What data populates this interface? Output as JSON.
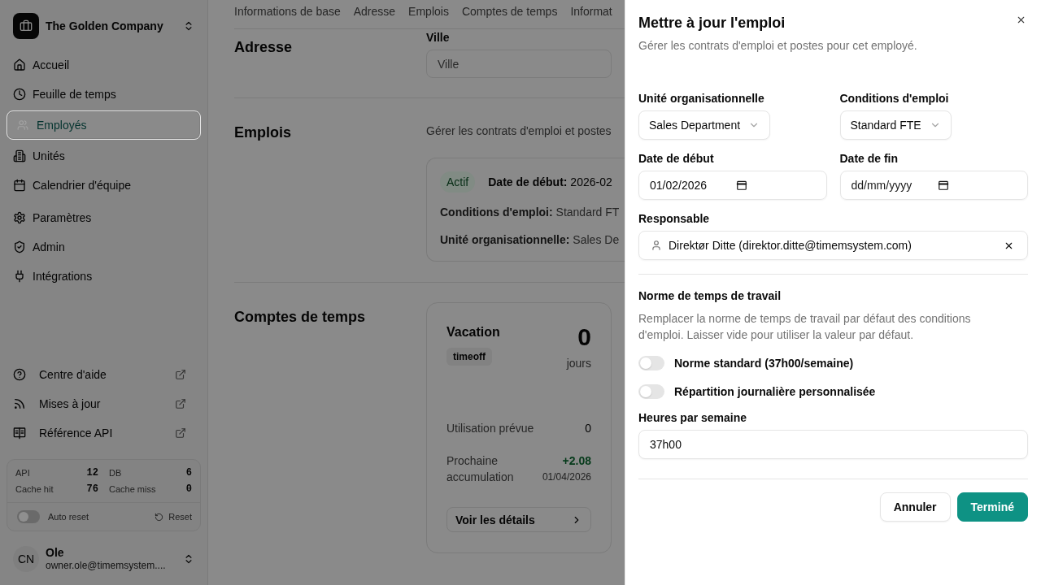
{
  "sidebar": {
    "company": "The Golden Company",
    "main_nav": [
      {
        "label": "Accueil",
        "selected": false
      },
      {
        "label": "Feuille de temps",
        "selected": false
      },
      {
        "label": "Employés",
        "selected": true
      },
      {
        "label": "Unités",
        "selected": false
      },
      {
        "label": "Calendrier d'équipe",
        "selected": false
      }
    ],
    "settings_nav": [
      {
        "label": "Paramètres",
        "selected": false
      },
      {
        "label": "Admin",
        "selected": false
      },
      {
        "label": "Intégrations",
        "selected": false
      }
    ],
    "resource_links": [
      "Centre d'aide",
      "Mises à jour",
      "Référence API"
    ],
    "stats": {
      "metrics": [
        {
          "label": "API",
          "value": "12"
        },
        {
          "label": "DB",
          "value": "6"
        },
        {
          "label": "Cache hit",
          "value": "76"
        },
        {
          "label": "Cache miss",
          "value": "0"
        }
      ],
      "auto_reset": {
        "label": "Auto reset",
        "on": false
      },
      "reset_button": "Reset"
    },
    "user": {
      "initials": "CN",
      "name": "Ole",
      "email": "owner.ole@timemsystem...."
    }
  },
  "page": {
    "tabs": [
      "Informations de base",
      "Adresse",
      "Emplois",
      "Comptes de temps",
      "Informat"
    ],
    "address": {
      "heading": "Adresse",
      "field_label": "Ville",
      "placeholder": "Ville"
    },
    "employment": {
      "heading": "Emplois",
      "description": "Gérer les contrats d'emploi et postes",
      "card": {
        "status": "Actif",
        "lines": [
          "**Date de début:** 2026-02",
          "**Conditions d'emploi:** Standard FT",
          "**Unité organisationnelle:** Sales De"
        ]
      }
    },
    "time_accounts": {
      "heading": "Comptes de temps",
      "card": {
        "name": "Vacation",
        "type": "timeoff",
        "balance": "0",
        "unit": "jours",
        "rows": [
          {
            "kind": "plain",
            "label": "Utilisation prévue",
            "value": "0"
          },
          {
            "kind": "accrual",
            "label": "Prochaine accumulation",
            "value": "+2.08",
            "date": "01/04/2026"
          }
        ],
        "details_button": "Voir les détails"
      }
    }
  },
  "drawer": {
    "title": "Mettre à jour l'emploi",
    "description": "Gérer les contrats d'emploi et postes pour cet employé.",
    "org_unit": {
      "label": "Unité organisationnelle",
      "value": "Sales Department"
    },
    "employment_terms": {
      "label": "Conditions d'emploi",
      "value": "Standard FTE"
    },
    "start_date": {
      "label": "Date de début",
      "value": "01/02/2026"
    },
    "end_date": {
      "label": "Date de fin",
      "placeholder": "dd/mm/yyyy"
    },
    "manager": {
      "label": "Responsable",
      "value": "Direktør Ditte (direktor.ditte@timemsystem.com)"
    },
    "working_time": {
      "heading": "Norme de temps de travail",
      "description": "Remplacer la norme de temps de travail par défaut des conditions d'emploi. Laisser vide pour utiliser la valeur par défaut.",
      "options": [
        {
          "label": "Norme standard (37h00/semaine)",
          "on": false
        },
        {
          "label": "Répartition journalière personnalisée",
          "on": false
        }
      ],
      "hours": {
        "label": "Heures par semaine",
        "value": "37h00"
      }
    },
    "buttons": [
      {
        "label": "Annuler",
        "kind": "secondary"
      },
      {
        "label": "Terminé",
        "kind": "primary"
      }
    ]
  }
}
